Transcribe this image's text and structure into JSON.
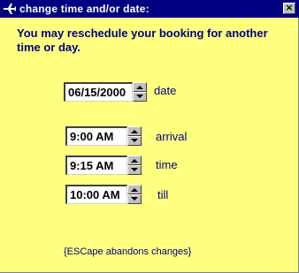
{
  "window": {
    "title": "change time and/or date:",
    "close_glyph": "×",
    "icon": "airplane-icon",
    "background": "#ffff80",
    "titlebar_color": "#000080"
  },
  "message": "You may reschedule your booking for another time or day.",
  "fields": {
    "date": {
      "value": "06/15/2000",
      "label": "date"
    },
    "arrival": {
      "value": "9:00 AM",
      "label": "arrival"
    },
    "time": {
      "value": "9:15 AM",
      "label": "time"
    },
    "till": {
      "value": "10:00 AM",
      "label": "till"
    }
  },
  "hint": "{ESCape abandons changes}"
}
